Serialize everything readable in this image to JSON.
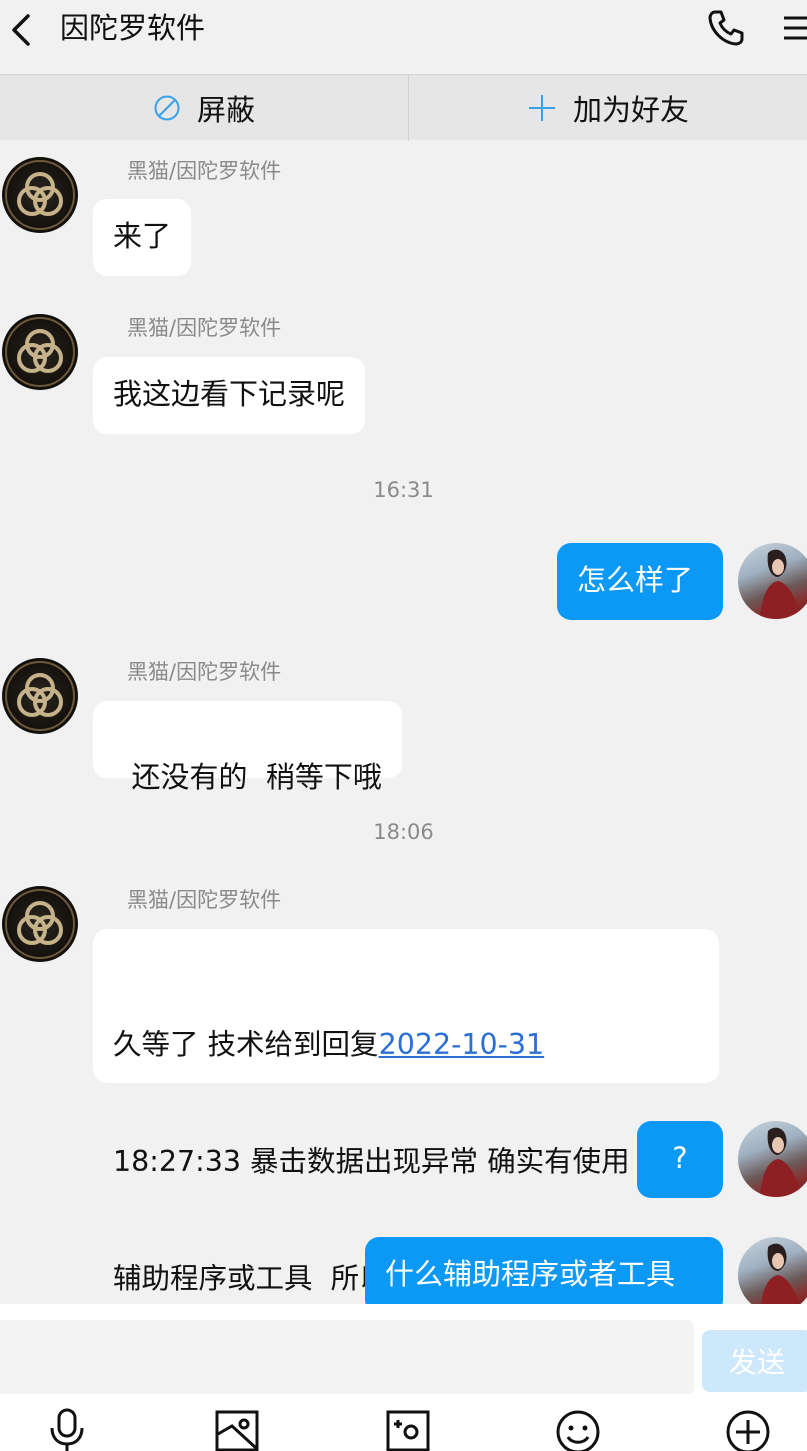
{
  "header": {
    "title": "因陀罗软件"
  },
  "actions": {
    "block_label": "屏蔽",
    "add_friend_label": "加为好友"
  },
  "messages": [
    {
      "sender": "黑猫/因陀罗软件",
      "text": "来了"
    },
    {
      "sender": "黑猫/因陀罗软件",
      "text": "我这边看下记录呢"
    },
    {
      "time": "16:31"
    },
    {
      "text": "怎么样了"
    },
    {
      "sender": "黑猫/因陀罗软件",
      "text": "还没有的  稍等下哦"
    },
    {
      "time": "18:06"
    },
    {
      "sender": "黑猫/因陀罗软件",
      "text_prefix": "久等了 技术给到回复",
      "link": "2022-10-31",
      "text_suffix_line2": "18:27:33 暴击数据出现异常 确实有使用",
      "text_line3": "辅助程序或工具  所以这边进行封禁了 ~"
    },
    {
      "text": "?"
    },
    {
      "text": "什么辅助程序或者工具"
    }
  ],
  "input": {
    "send_label": "发送",
    "value": ""
  },
  "toolbar": {
    "icons": [
      "microphone-icon",
      "photo-icon",
      "camera-icon",
      "emoji-icon",
      "plus-icon"
    ]
  },
  "colors": {
    "outgoing_bubble": "#0c99f5",
    "link": "#2b6fd6",
    "send_disabled": "#cde8fb",
    "icon_blue": "#3aa0e8"
  }
}
